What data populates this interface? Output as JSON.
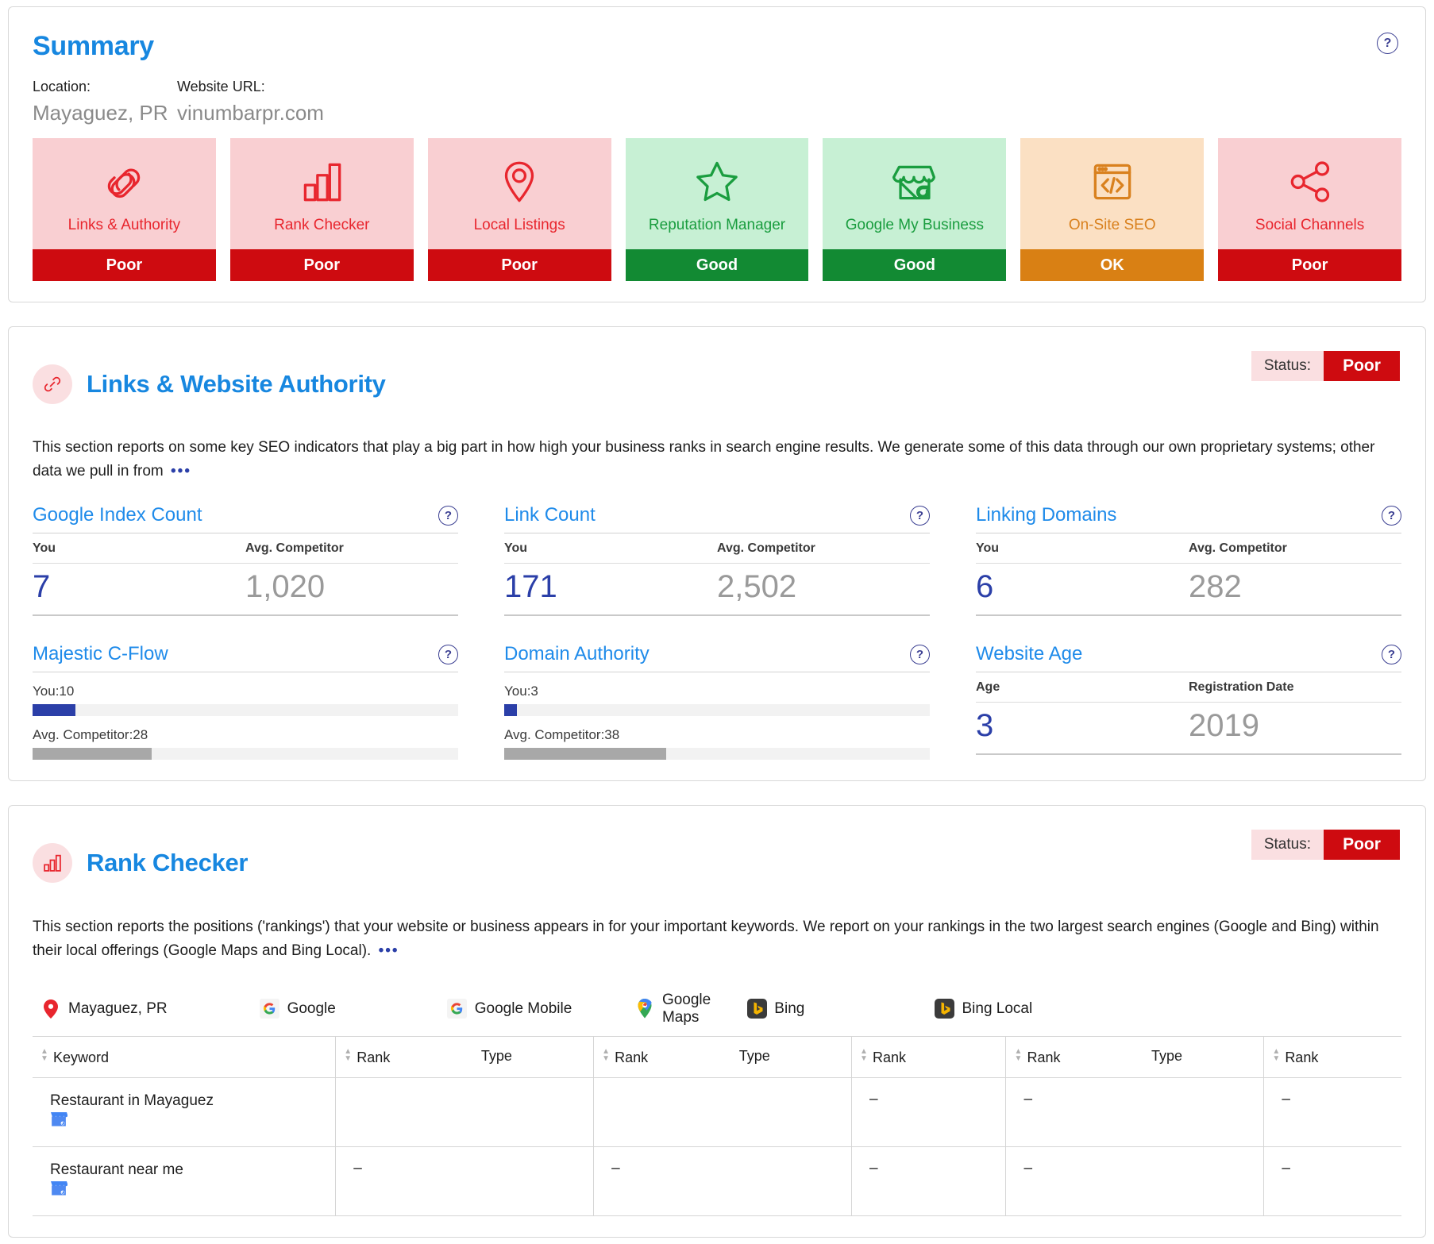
{
  "summary": {
    "title": "Summary",
    "help_icon": "question-mark-icon",
    "location_label": "Location:",
    "location_value": "Mayaguez, PR",
    "url_label": "Website URL:",
    "url_value": "vinumbarpr.com",
    "cards": [
      {
        "name": "Links & Authority",
        "icon": "link-chain-icon",
        "status": "Poor",
        "tone": "poor"
      },
      {
        "name": "Rank Checker",
        "icon": "bar-chart-icon",
        "status": "Poor",
        "tone": "poor"
      },
      {
        "name": "Local Listings",
        "icon": "map-pin-icon",
        "status": "Poor",
        "tone": "poor"
      },
      {
        "name": "Reputation Manager",
        "icon": "star-icon",
        "status": "Good",
        "tone": "good"
      },
      {
        "name": "Google My Business",
        "icon": "storefront-g-icon",
        "status": "Good",
        "tone": "good"
      },
      {
        "name": "On-Site SEO",
        "icon": "code-browser-icon",
        "status": "OK",
        "tone": "ok"
      },
      {
        "name": "Social Channels",
        "icon": "share-nodes-icon",
        "status": "Poor",
        "tone": "poor"
      }
    ]
  },
  "links_section": {
    "icon": "link-chain-icon",
    "title": "Links & Website Authority",
    "status_label": "Status:",
    "status_value": "Poor",
    "description": "This section reports on some key SEO indicators that play a big part in how high your business ranks in search engine results. We generate some of this data through our own proprietary systems; other data we pull in from",
    "more_ellipsis": "•••",
    "metrics": [
      {
        "title": "Google Index Count",
        "help_icon": "question-mark-icon",
        "type": "compare",
        "col1_label": "You",
        "col2_label": "Avg. Competitor",
        "col1_value": "7",
        "col2_value": "1,020"
      },
      {
        "title": "Link Count",
        "help_icon": "question-mark-icon",
        "type": "compare",
        "col1_label": "You",
        "col2_label": "Avg. Competitor",
        "col1_value": "171",
        "col2_value": "2,502"
      },
      {
        "title": "Linking Domains",
        "help_icon": "question-mark-icon",
        "type": "compare",
        "col1_label": "You",
        "col2_label": "Avg. Competitor",
        "col1_value": "6",
        "col2_value": "282"
      },
      {
        "title": "Majestic C-Flow",
        "help_icon": "question-mark-icon",
        "type": "bars",
        "you_label": "You:10",
        "you_value": 10,
        "comp_label": "Avg. Competitor:28",
        "comp_value": 28,
        "scale_max": 100
      },
      {
        "title": "Domain Authority",
        "help_icon": "question-mark-icon",
        "type": "bars",
        "you_label": "You:3",
        "you_value": 3,
        "comp_label": "Avg. Competitor:38",
        "comp_value": 38,
        "scale_max": 100
      },
      {
        "title": "Website Age",
        "help_icon": "question-mark-icon",
        "type": "compare",
        "col1_label": "Age",
        "col2_label": "Registration Date",
        "col1_value": "3",
        "col2_value": "2019"
      }
    ]
  },
  "rank_section": {
    "icon": "bar-chart-icon",
    "title": "Rank Checker",
    "status_label": "Status:",
    "status_value": "Poor",
    "description": "This section reports the positions ('rankings') that your website or business appears in for your important keywords. We report on your rankings in the two largest search engines (Google and Bing) within their local offerings (Google Maps and Bing Local).",
    "more_ellipsis": "•••",
    "engines": [
      {
        "label": "Mayaguez, PR",
        "icon": "map-pin-icon"
      },
      {
        "label": "Google",
        "icon": "google-icon"
      },
      {
        "label": "Google Mobile",
        "icon": "google-icon"
      },
      {
        "label": "Google Maps",
        "icon": "google-maps-pin-icon"
      },
      {
        "label": "Bing",
        "icon": "bing-icon"
      },
      {
        "label": "Bing Local",
        "icon": "bing-icon"
      }
    ],
    "columns": [
      {
        "label": "Keyword",
        "sortable": true
      },
      {
        "label": "Rank",
        "sortable": true
      },
      {
        "label": "Type",
        "sortable": false
      },
      {
        "label": "Rank",
        "sortable": true
      },
      {
        "label": "Type",
        "sortable": false
      },
      {
        "label": "Rank",
        "sortable": true
      },
      {
        "label": "Rank",
        "sortable": true
      },
      {
        "label": "Type",
        "sortable": false
      },
      {
        "label": "Rank",
        "sortable": true
      }
    ],
    "rows": [
      {
        "keyword": "Restaurant in Mayaguez",
        "badge_icon": "gmb-storefront-icon",
        "google_rank": "",
        "google_type": "",
        "google_mobile_rank": "",
        "google_mobile_type": "",
        "google_maps_rank": "–",
        "bing_rank": "–",
        "bing_type": "",
        "bing_local_rank": "–"
      },
      {
        "keyword": "Restaurant near me",
        "badge_icon": "gmb-storefront-icon",
        "google_rank": "–",
        "google_type": "",
        "google_mobile_rank": "–",
        "google_mobile_type": "",
        "google_maps_rank": "–",
        "bing_rank": "–",
        "bing_type": "",
        "bing_local_rank": "–"
      }
    ]
  },
  "colors": {
    "brand_blue": "#1787e0",
    "poor_red": "#ce0b10",
    "good_green": "#128a33",
    "ok_orange": "#d98014",
    "you_navy": "#2b3fa8",
    "competitor_grey": "#9a9a9a"
  }
}
